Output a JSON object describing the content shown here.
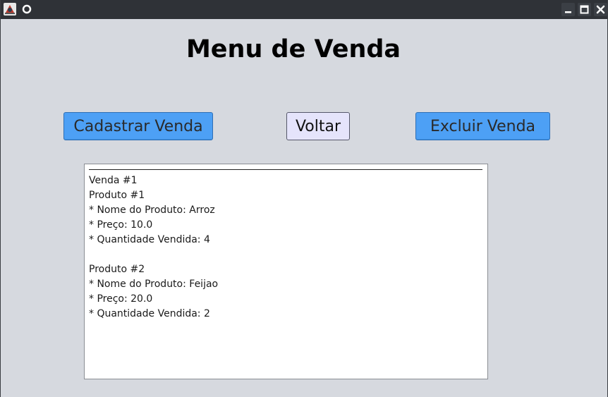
{
  "window": {
    "heading": "Menu de Venda"
  },
  "buttons": {
    "cadastrar": "Cadastrar Venda",
    "voltar": "Voltar",
    "excluir": "Excluir Venda"
  },
  "sales_text": [
    "Venda #1",
    "Produto #1",
    "* Nome do Produto: Arroz",
    "* Preço: 10.0",
    "* Quantidade Vendida: 4",
    "",
    "Produto #2",
    "* Nome do Produto: Feijao",
    "* Preço: 20.0",
    "* Quantidade Vendida: 2"
  ],
  "colors": {
    "primary_button": "#4da0f5",
    "secondary_button": "#e5e4fb",
    "background": "#d6d9df",
    "titlebar": "#2f3237"
  },
  "icons": {
    "app": "java-app-icon",
    "menu": "window-menu-icon",
    "minimize": "minimize-icon",
    "maximize": "maximize-icon",
    "close": "close-icon"
  }
}
